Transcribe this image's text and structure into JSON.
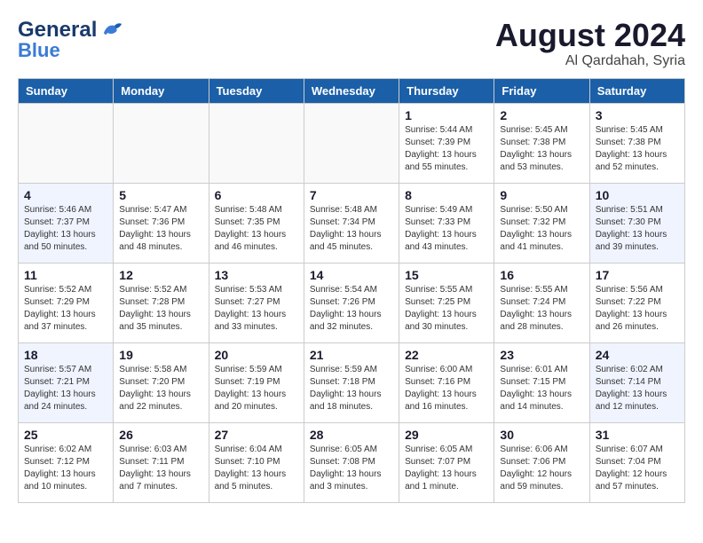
{
  "header": {
    "logo_general": "General",
    "logo_blue": "Blue",
    "month": "August 2024",
    "location": "Al Qardahah, Syria"
  },
  "weekdays": [
    "Sunday",
    "Monday",
    "Tuesday",
    "Wednesday",
    "Thursday",
    "Friday",
    "Saturday"
  ],
  "weeks": [
    [
      {
        "day": "",
        "info": ""
      },
      {
        "day": "",
        "info": ""
      },
      {
        "day": "",
        "info": ""
      },
      {
        "day": "",
        "info": ""
      },
      {
        "day": "1",
        "info": "Sunrise: 5:44 AM\nSunset: 7:39 PM\nDaylight: 13 hours\nand 55 minutes."
      },
      {
        "day": "2",
        "info": "Sunrise: 5:45 AM\nSunset: 7:38 PM\nDaylight: 13 hours\nand 53 minutes."
      },
      {
        "day": "3",
        "info": "Sunrise: 5:45 AM\nSunset: 7:38 PM\nDaylight: 13 hours\nand 52 minutes."
      }
    ],
    [
      {
        "day": "4",
        "info": "Sunrise: 5:46 AM\nSunset: 7:37 PM\nDaylight: 13 hours\nand 50 minutes."
      },
      {
        "day": "5",
        "info": "Sunrise: 5:47 AM\nSunset: 7:36 PM\nDaylight: 13 hours\nand 48 minutes."
      },
      {
        "day": "6",
        "info": "Sunrise: 5:48 AM\nSunset: 7:35 PM\nDaylight: 13 hours\nand 46 minutes."
      },
      {
        "day": "7",
        "info": "Sunrise: 5:48 AM\nSunset: 7:34 PM\nDaylight: 13 hours\nand 45 minutes."
      },
      {
        "day": "8",
        "info": "Sunrise: 5:49 AM\nSunset: 7:33 PM\nDaylight: 13 hours\nand 43 minutes."
      },
      {
        "day": "9",
        "info": "Sunrise: 5:50 AM\nSunset: 7:32 PM\nDaylight: 13 hours\nand 41 minutes."
      },
      {
        "day": "10",
        "info": "Sunrise: 5:51 AM\nSunset: 7:30 PM\nDaylight: 13 hours\nand 39 minutes."
      }
    ],
    [
      {
        "day": "11",
        "info": "Sunrise: 5:52 AM\nSunset: 7:29 PM\nDaylight: 13 hours\nand 37 minutes."
      },
      {
        "day": "12",
        "info": "Sunrise: 5:52 AM\nSunset: 7:28 PM\nDaylight: 13 hours\nand 35 minutes."
      },
      {
        "day": "13",
        "info": "Sunrise: 5:53 AM\nSunset: 7:27 PM\nDaylight: 13 hours\nand 33 minutes."
      },
      {
        "day": "14",
        "info": "Sunrise: 5:54 AM\nSunset: 7:26 PM\nDaylight: 13 hours\nand 32 minutes."
      },
      {
        "day": "15",
        "info": "Sunrise: 5:55 AM\nSunset: 7:25 PM\nDaylight: 13 hours\nand 30 minutes."
      },
      {
        "day": "16",
        "info": "Sunrise: 5:55 AM\nSunset: 7:24 PM\nDaylight: 13 hours\nand 28 minutes."
      },
      {
        "day": "17",
        "info": "Sunrise: 5:56 AM\nSunset: 7:22 PM\nDaylight: 13 hours\nand 26 minutes."
      }
    ],
    [
      {
        "day": "18",
        "info": "Sunrise: 5:57 AM\nSunset: 7:21 PM\nDaylight: 13 hours\nand 24 minutes."
      },
      {
        "day": "19",
        "info": "Sunrise: 5:58 AM\nSunset: 7:20 PM\nDaylight: 13 hours\nand 22 minutes."
      },
      {
        "day": "20",
        "info": "Sunrise: 5:59 AM\nSunset: 7:19 PM\nDaylight: 13 hours\nand 20 minutes."
      },
      {
        "day": "21",
        "info": "Sunrise: 5:59 AM\nSunset: 7:18 PM\nDaylight: 13 hours\nand 18 minutes."
      },
      {
        "day": "22",
        "info": "Sunrise: 6:00 AM\nSunset: 7:16 PM\nDaylight: 13 hours\nand 16 minutes."
      },
      {
        "day": "23",
        "info": "Sunrise: 6:01 AM\nSunset: 7:15 PM\nDaylight: 13 hours\nand 14 minutes."
      },
      {
        "day": "24",
        "info": "Sunrise: 6:02 AM\nSunset: 7:14 PM\nDaylight: 13 hours\nand 12 minutes."
      }
    ],
    [
      {
        "day": "25",
        "info": "Sunrise: 6:02 AM\nSunset: 7:12 PM\nDaylight: 13 hours\nand 10 minutes."
      },
      {
        "day": "26",
        "info": "Sunrise: 6:03 AM\nSunset: 7:11 PM\nDaylight: 13 hours\nand 7 minutes."
      },
      {
        "day": "27",
        "info": "Sunrise: 6:04 AM\nSunset: 7:10 PM\nDaylight: 13 hours\nand 5 minutes."
      },
      {
        "day": "28",
        "info": "Sunrise: 6:05 AM\nSunset: 7:08 PM\nDaylight: 13 hours\nand 3 minutes."
      },
      {
        "day": "29",
        "info": "Sunrise: 6:05 AM\nSunset: 7:07 PM\nDaylight: 13 hours\nand 1 minute."
      },
      {
        "day": "30",
        "info": "Sunrise: 6:06 AM\nSunset: 7:06 PM\nDaylight: 12 hours\nand 59 minutes."
      },
      {
        "day": "31",
        "info": "Sunrise: 6:07 AM\nSunset: 7:04 PM\nDaylight: 12 hours\nand 57 minutes."
      }
    ]
  ]
}
